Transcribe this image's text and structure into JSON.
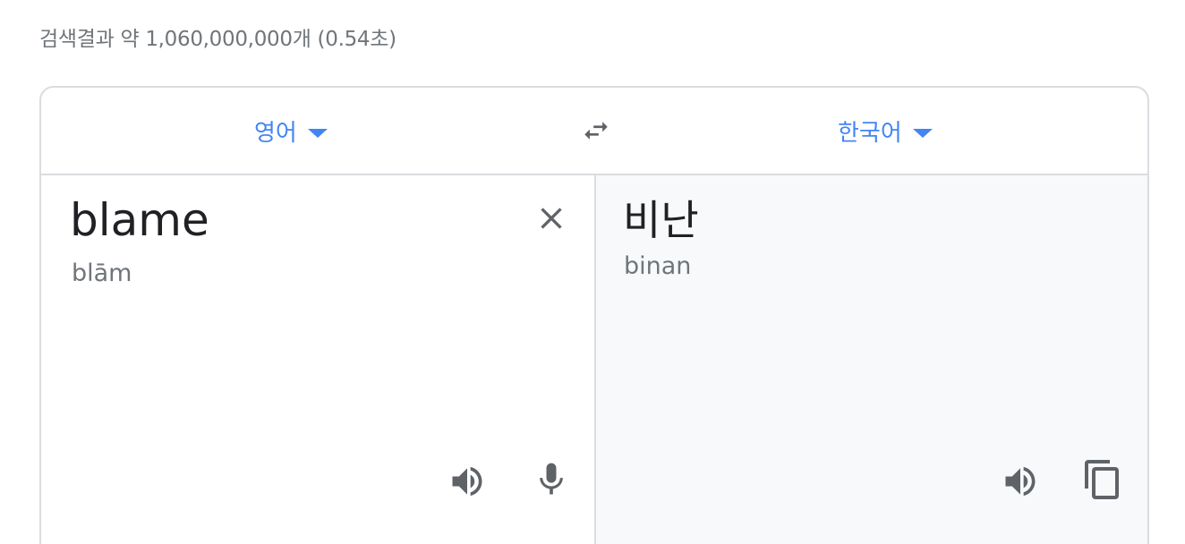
{
  "search": {
    "result_stats": "검색결과 약 1,060,000,000개 (0.54초)"
  },
  "translator": {
    "source_language": "영어",
    "target_language": "한국어",
    "source_text": "blame",
    "source_pronunciation": "blām",
    "translated_text": "비난",
    "translated_pronunciation": "binan",
    "colors": {
      "accent": "#4285f4",
      "icon": "#5f6368",
      "border": "#dadce0",
      "target_background": "#f8f9fa"
    },
    "icons": [
      "swap-languages-icon",
      "clear-icon",
      "speaker-icon",
      "microphone-icon",
      "copy-icon"
    ]
  }
}
